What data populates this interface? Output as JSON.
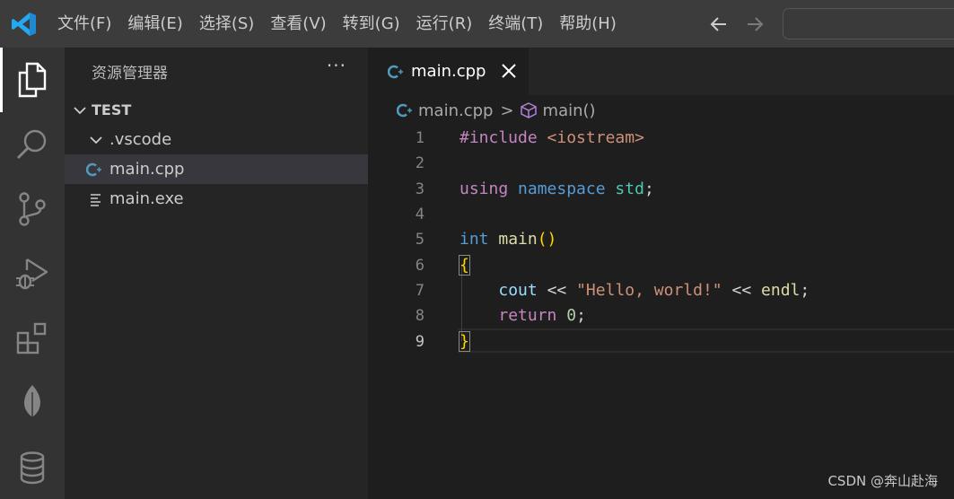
{
  "colors": {
    "titlebar_bg": "#3c3c3c",
    "activitybar_bg": "#333333",
    "sidebar_bg": "#252526",
    "editor_bg": "#1e1e1e",
    "cpp_icon": "#519aba"
  },
  "menu": [
    "文件(F)",
    "编辑(E)",
    "选择(S)",
    "查看(V)",
    "转到(G)",
    "运行(R)",
    "终端(T)",
    "帮助(H)"
  ],
  "activity_icons": [
    "explorer-icon",
    "search-icon",
    "source-control-icon",
    "run-debug-icon",
    "extensions-icon",
    "mongodb-leaf-icon",
    "database-icon"
  ],
  "sidebar": {
    "title": "资源管理器",
    "more": "···",
    "root": "TEST",
    "items": [
      {
        "label": ".vscode",
        "icon": "chevron-down-icon"
      },
      {
        "label": "main.cpp",
        "icon": "cpp-file-icon"
      },
      {
        "label": "main.exe",
        "icon": "text-file-icon"
      }
    ]
  },
  "tab": {
    "label": "main.cpp",
    "icon": "cpp-file-icon"
  },
  "breadcrumb": {
    "file": "main.cpp",
    "separator": ">",
    "symbol": "main()"
  },
  "editor": {
    "line_numbers": [
      "1",
      "2",
      "3",
      "4",
      "5",
      "6",
      "7",
      "8",
      "9"
    ],
    "active_line": "9",
    "code": {
      "l1_directive": "#include",
      "l1_header": "<iostream>",
      "l3_using": "using",
      "l3_namespace": "namespace",
      "l3_std": "std",
      "l3_semi": ";",
      "l5_int": "int",
      "l5_main": "main",
      "l5_parens": "()",
      "l6_open": "{",
      "l7_cout": "cout",
      "l7_op1": "<<",
      "l7_str": "\"Hello, world!\"",
      "l7_op2": "<<",
      "l7_endl": "endl",
      "l7_semi": ";",
      "l8_return": "return",
      "l8_zero": "0",
      "l8_semi": ";",
      "l9_close": "}"
    }
  },
  "watermark": "CSDN @奔山赴海"
}
